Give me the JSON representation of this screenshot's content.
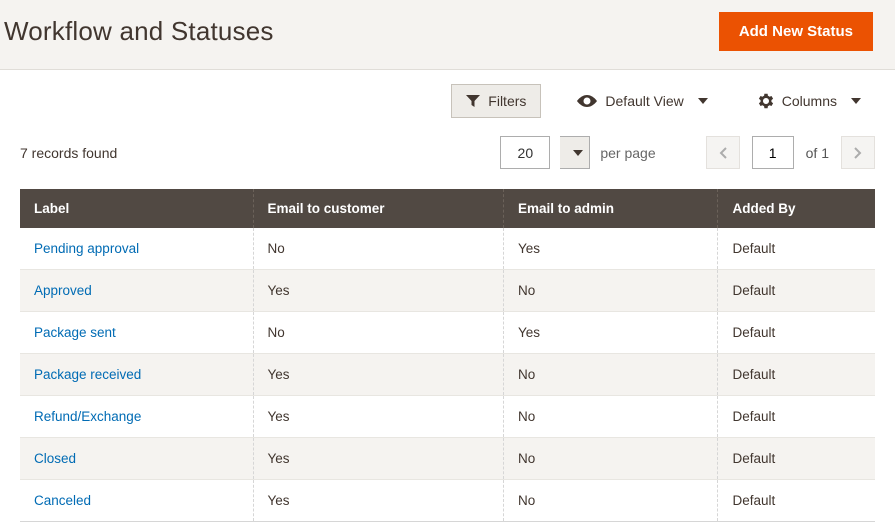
{
  "header": {
    "title": "Workflow and Statuses",
    "primary_button": "Add New Status"
  },
  "toolbar": {
    "filters": "Filters",
    "default_view": "Default View",
    "columns": "Columns"
  },
  "pager": {
    "records_found": "7 records found",
    "per_page_value": "20",
    "per_page_label": "per page",
    "current_page": "1",
    "of_label": "of",
    "total_pages": "1"
  },
  "table": {
    "headers": {
      "label": "Label",
      "email_customer": "Email to customer",
      "email_admin": "Email to admin",
      "added_by": "Added By"
    },
    "rows": [
      {
        "label": "Pending approval",
        "email_customer": "No",
        "email_admin": "Yes",
        "added_by": "Default"
      },
      {
        "label": "Approved",
        "email_customer": "Yes",
        "email_admin": "No",
        "added_by": "Default"
      },
      {
        "label": "Package sent",
        "email_customer": "No",
        "email_admin": "Yes",
        "added_by": "Default"
      },
      {
        "label": "Package received",
        "email_customer": "Yes",
        "email_admin": "No",
        "added_by": "Default"
      },
      {
        "label": "Refund/Exchange",
        "email_customer": "Yes",
        "email_admin": "No",
        "added_by": "Default"
      },
      {
        "label": "Closed",
        "email_customer": "Yes",
        "email_admin": "No",
        "added_by": "Default"
      },
      {
        "label": "Canceled",
        "email_customer": "Yes",
        "email_admin": "No",
        "added_by": "Default"
      }
    ]
  }
}
